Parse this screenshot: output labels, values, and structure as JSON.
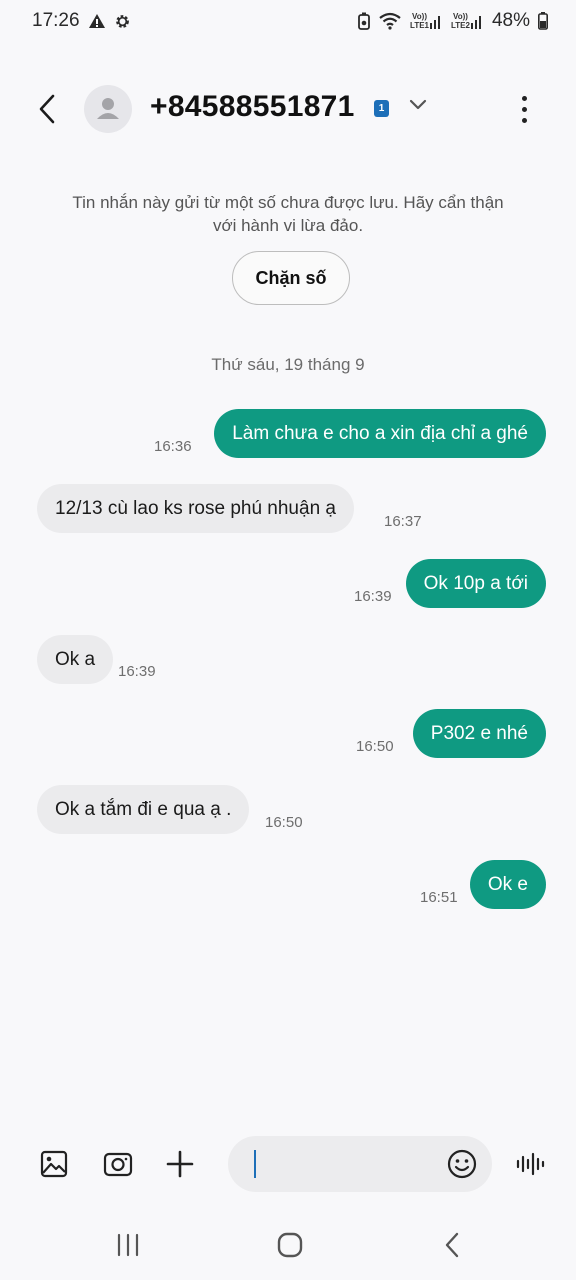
{
  "status_bar": {
    "time": "17:26",
    "net1_top": "Vo))",
    "net1_bottom": "LTE1",
    "net2_top": "Vo))",
    "net2_bottom": "LTE2",
    "battery": "48%",
    "icons": [
      "warning-icon",
      "gear-icon",
      "battery-saver-icon",
      "wifi-icon",
      "signal-icon",
      "battery-icon"
    ]
  },
  "header": {
    "contact": "+84588551871",
    "sim_badge": "1",
    "icons": [
      "back-icon",
      "contact-avatar-icon",
      "chevron-down-icon",
      "more-options-icon"
    ]
  },
  "warning": {
    "text": "Tin nhắn này gửi từ một số chưa được lưu. Hãy cẩn thận với hành vi lừa đảo.",
    "block_label": "Chặn số"
  },
  "date_separator": "Thứ sáu, 19 tháng 9",
  "messages": [
    {
      "dir": "out",
      "text": "Làm chưa e cho a xin địa chỉ a ghé",
      "time": "16:36"
    },
    {
      "dir": "in",
      "text": "12/13  cù lao ks rose phú nhuận ạ",
      "time": "16:37"
    },
    {
      "dir": "out",
      "text": "Ok 10p a tới",
      "time": "16:39"
    },
    {
      "dir": "in",
      "text": "Ok a",
      "time": "16:39"
    },
    {
      "dir": "out",
      "text": "P302 e nhé",
      "time": "16:50"
    },
    {
      "dir": "in",
      "text": "Ok a tắm đi e qua ạ .",
      "time": "16:50"
    },
    {
      "dir": "out",
      "text": "Ok e",
      "time": "16:51"
    }
  ],
  "composer": {
    "input_value": "",
    "icons": [
      "gallery-icon",
      "camera-icon",
      "plus-icon",
      "emoji-icon",
      "voice-record-icon"
    ]
  },
  "nav_bar": {
    "icons": [
      "recent-apps-icon",
      "home-icon",
      "back-nav-icon"
    ]
  },
  "colors": {
    "accent": "#0f9a82",
    "incoming_bubble": "#ebebed",
    "background": "#f8f8fa"
  }
}
